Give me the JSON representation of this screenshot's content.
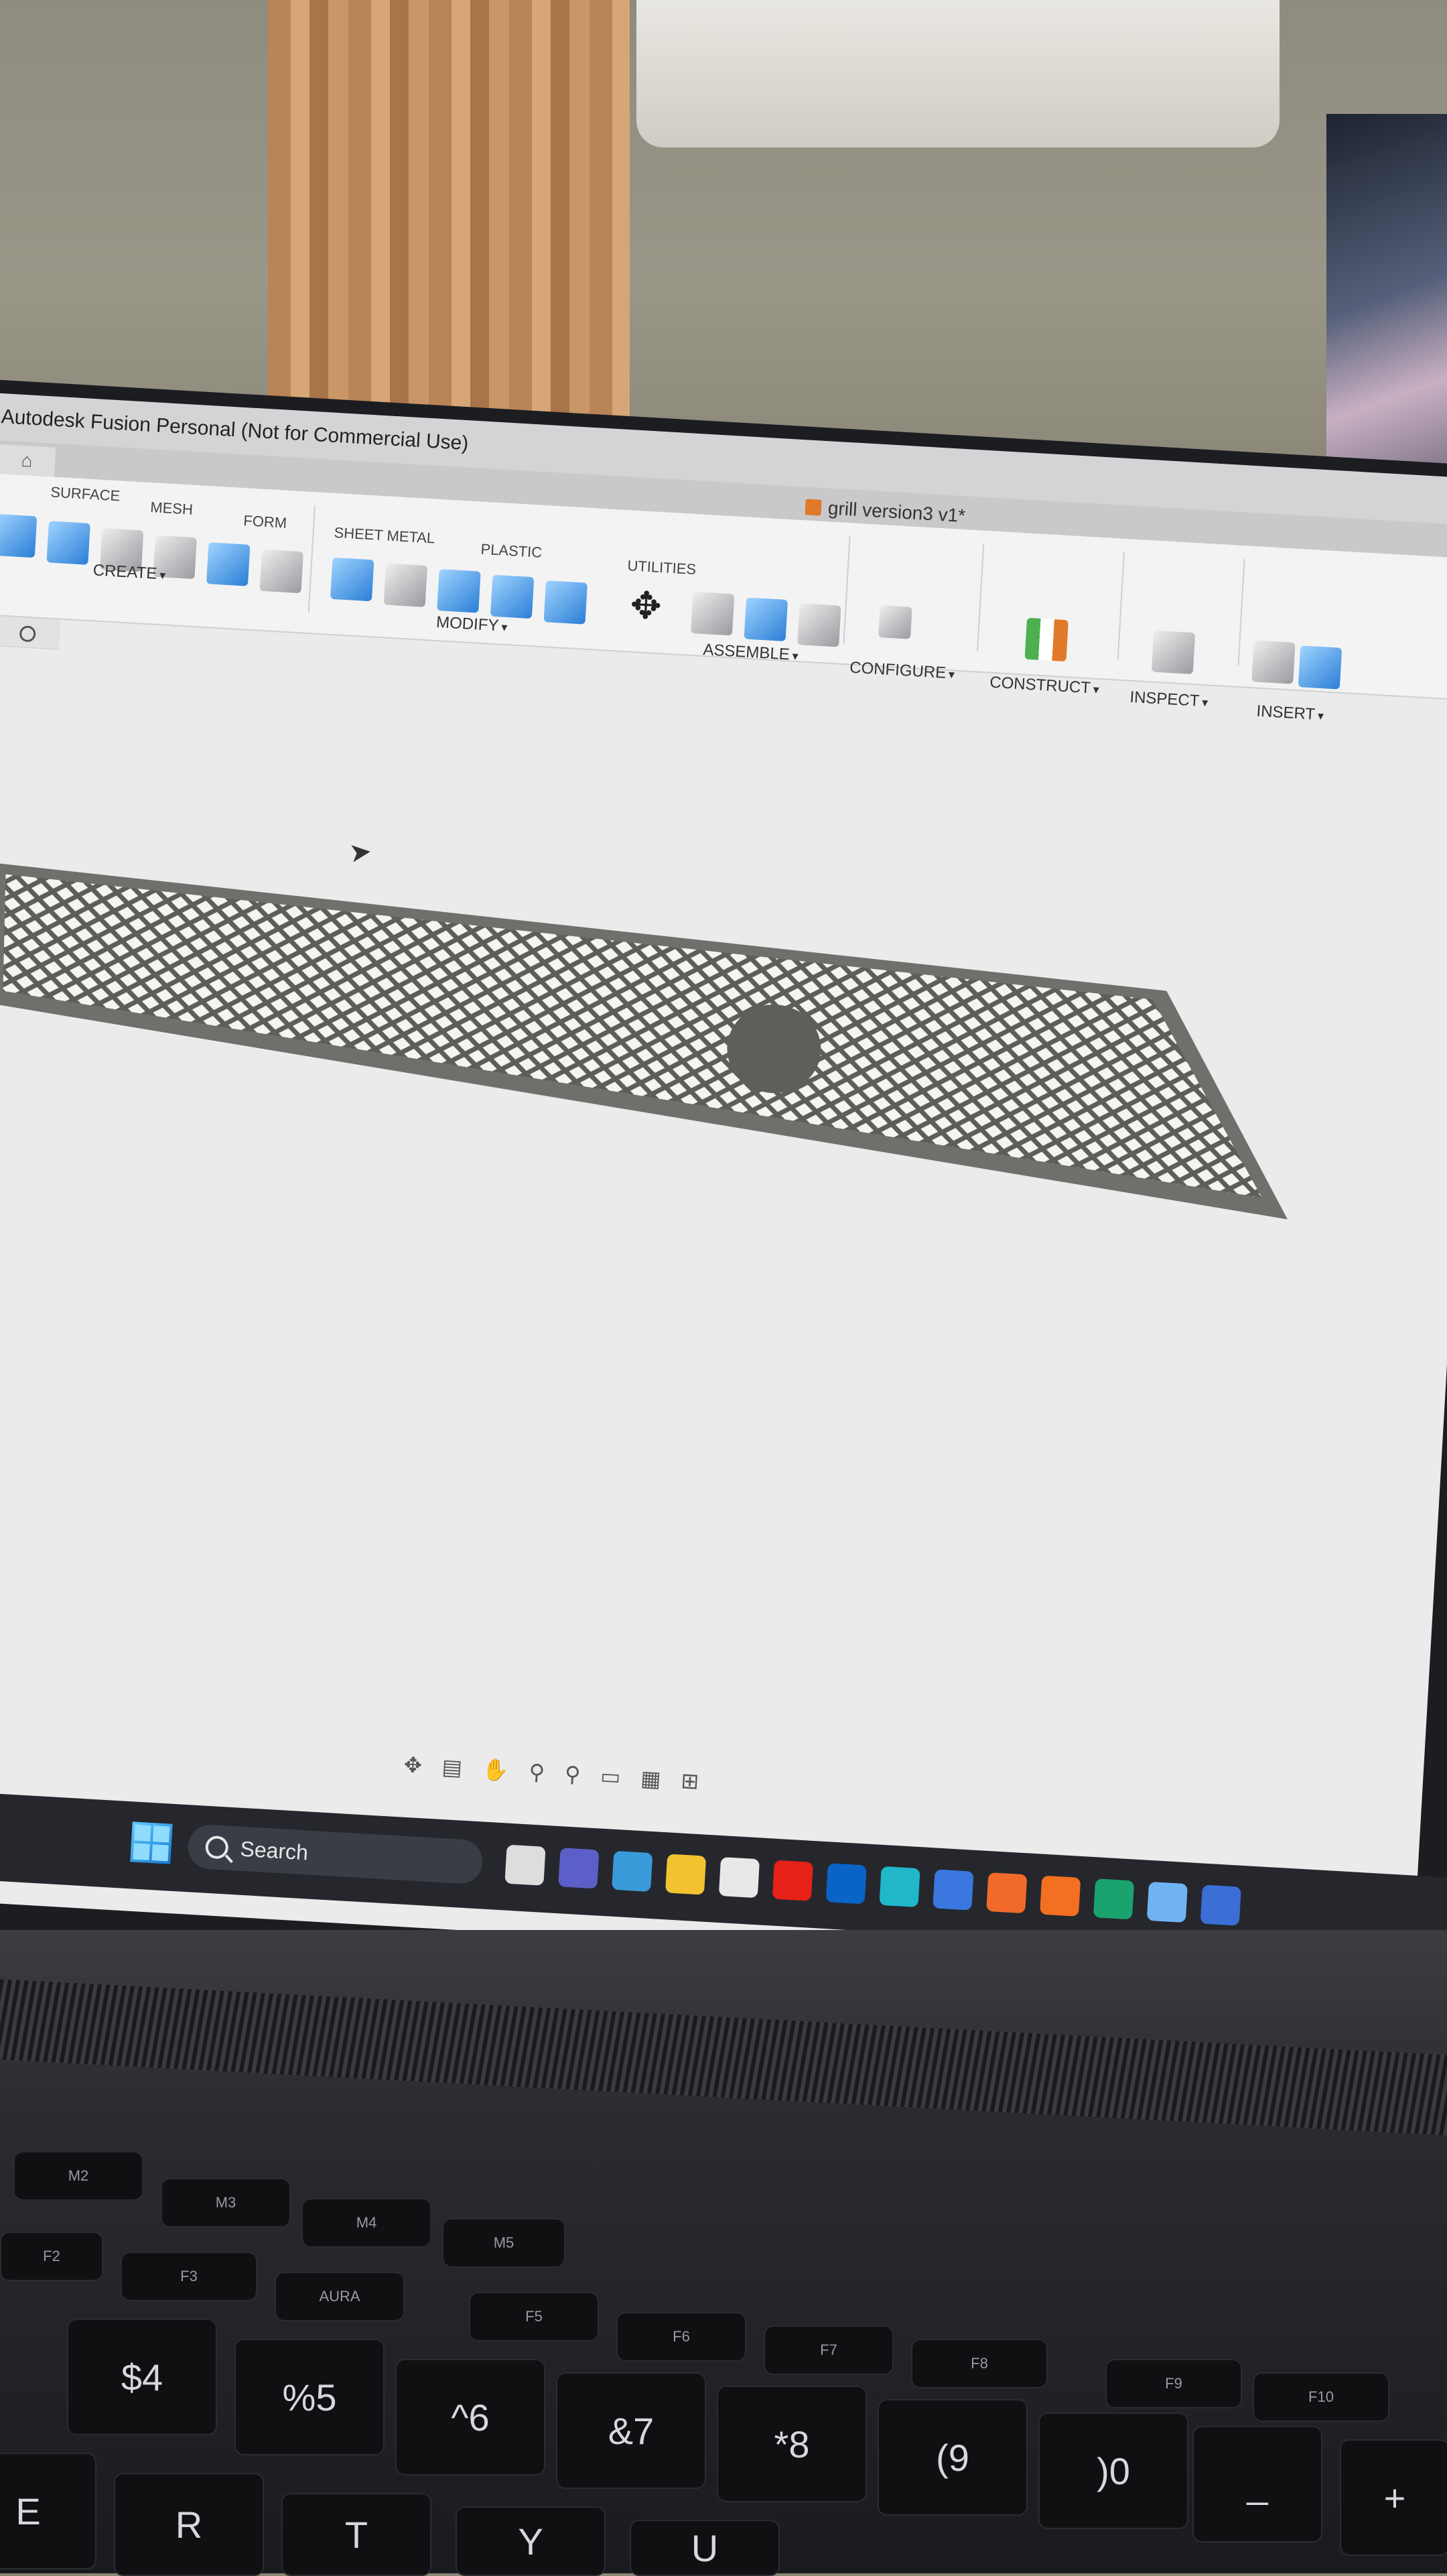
{
  "window": {
    "title": "Autodesk Fusion Personal (Not for Commercial Use)",
    "document_tab": "grill version3 v1*"
  },
  "toolbar": {
    "groups": [
      {
        "label": "CREATE",
        "sub": [
          "SURFACE",
          "MESH",
          "FORM"
        ]
      },
      {
        "label": "MODIFY",
        "sub": [
          "SHEET METAL",
          "PLASTIC"
        ]
      },
      {
        "label": "ASSEMBLE",
        "sub": [
          "UTILITIES"
        ]
      },
      {
        "label": "CONFIGURE"
      },
      {
        "label": "CONSTRUCT"
      },
      {
        "label": "INSPECT"
      },
      {
        "label": "INSERT"
      }
    ]
  },
  "taskbar": {
    "search_placeholder": "Search"
  },
  "keyboard": {
    "fn_keys": [
      "M2",
      "M3",
      "M4",
      "M5",
      "F2",
      "F3",
      "AURA",
      "F5",
      "F6",
      "F7",
      "F8",
      "F9",
      "F10"
    ],
    "number_keys": [
      "$4",
      "%5",
      "^6",
      "&7",
      "*8",
      "(9",
      ")0",
      "_",
      "+"
    ],
    "letter_keys": [
      "E",
      "R",
      "T",
      "Y",
      "U"
    ]
  },
  "colors": {
    "canvas": "#ebebec",
    "model": "#6f6f6c",
    "accent": "#2b7fd6"
  }
}
